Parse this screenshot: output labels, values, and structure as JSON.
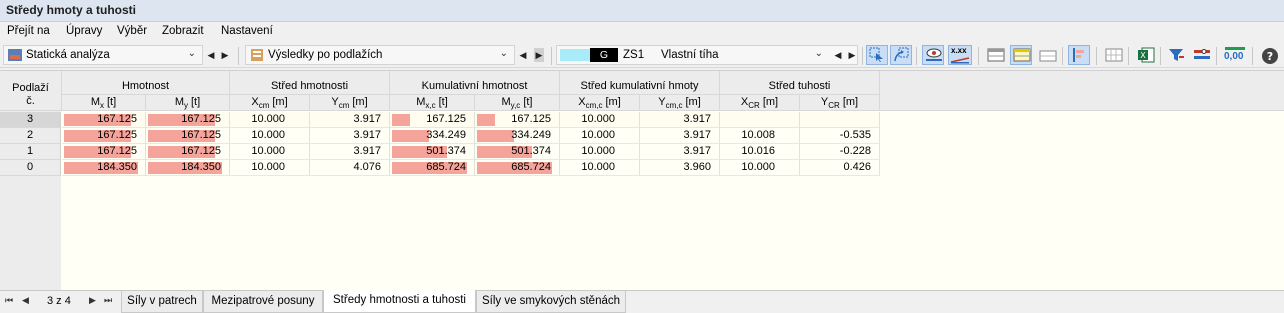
{
  "window": {
    "title": "Středy hmoty a tuhosti"
  },
  "menu": [
    "Přejít na",
    "Úpravy",
    "Výběr",
    "Zobrazit",
    "Nastavení"
  ],
  "toolbar": {
    "analysis_combo": "Statická analýza",
    "results_combo": "Výsledky po podlažích",
    "loadcase_badge": "G",
    "loadcase_id": "ZS1",
    "loadcase_name": "Vlastní tíha",
    "decimals_label": "0,00",
    "xxx_label": "x.xx"
  },
  "table": {
    "rowheader_title": "Podlaží",
    "rowheader_sub": "č.",
    "groups": [
      "Hmotnost",
      "Střed hmotnosti",
      "Kumulativní hmotnost",
      "Střed kumulativní hmoty",
      "Střed tuhosti"
    ],
    "columns": [
      {
        "base": "M",
        "sub": "x",
        "unit": "[t]"
      },
      {
        "base": "M",
        "sub": "y",
        "unit": "[t]"
      },
      {
        "base": "X",
        "sub": "cm",
        "unit": "[m]"
      },
      {
        "base": "Y",
        "sub": "cm",
        "unit": "[m]"
      },
      {
        "base": "M",
        "sub": "x,c",
        "unit": "[t]"
      },
      {
        "base": "M",
        "sub": "y,c",
        "unit": "[t]"
      },
      {
        "base": "X",
        "sub": "cm,c",
        "unit": "[m]"
      },
      {
        "base": "Y",
        "sub": "cm,c",
        "unit": "[m]"
      },
      {
        "base": "X",
        "sub": "CR",
        "unit": "[m]"
      },
      {
        "base": "Y",
        "sub": "CR",
        "unit": "[m]"
      }
    ],
    "rows": [
      {
        "storey": "3",
        "values": [
          "167.125",
          "167.125",
          "10.000",
          "3.917",
          "167.125",
          "167.125",
          "10.000",
          "3.917",
          "",
          ""
        ],
        "mass_fraction": 0.9066,
        "cum_fraction": 0.2437
      },
      {
        "storey": "2",
        "values": [
          "167.125",
          "167.125",
          "10.000",
          "3.917",
          "334.249",
          "334.249",
          "10.000",
          "3.917",
          "10.008",
          "-0.535"
        ],
        "mass_fraction": 0.9066,
        "cum_fraction": 0.4874
      },
      {
        "storey": "1",
        "values": [
          "167.125",
          "167.125",
          "10.000",
          "3.917",
          "501.374",
          "501.374",
          "10.000",
          "3.917",
          "10.016",
          "-0.228"
        ],
        "mass_fraction": 0.9066,
        "cum_fraction": 0.7311
      },
      {
        "storey": "0",
        "values": [
          "184.350",
          "184.350",
          "10.000",
          "4.076",
          "685.724",
          "685.724",
          "10.000",
          "3.960",
          "10.000",
          "0.426"
        ],
        "mass_fraction": 1.0,
        "cum_fraction": 1.0
      }
    ]
  },
  "tabs": {
    "page_indicator": "3 z 4",
    "items": [
      "Síly v patrech",
      "Mezipatrové posuny",
      "Středy hmotnosti a tuhosti",
      "Síly ve smykových stěnách"
    ],
    "active_index": 2
  },
  "colors": {
    "bar": "#f4a49a",
    "grid_bg": "#fffff6",
    "header_bg": "#ececec",
    "active_tool": "#c9def5"
  }
}
